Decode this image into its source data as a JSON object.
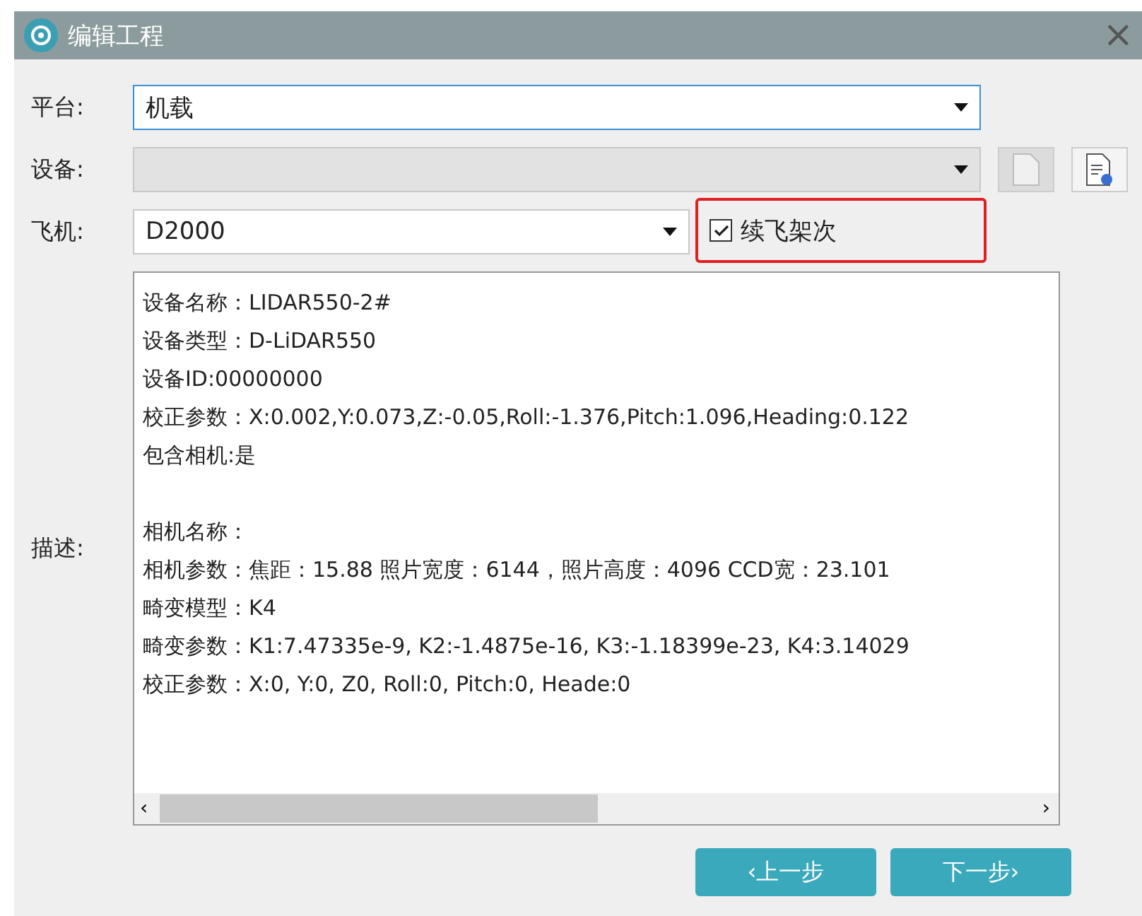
{
  "window": {
    "title": "编辑工程",
    "close": "×"
  },
  "fields": [
    {
      "label": "平台:",
      "value": "机载",
      "focused": true,
      "disabled": false
    },
    {
      "label": "设备:",
      "focused": false,
      "disabled": true
    },
    {
      "label": "飞机:",
      "value": "D2000",
      "focused": false,
      "disabled": false
    }
  ],
  "resume_checkbox": {
    "label": "续飞架次",
    "checked": true
  },
  "description": {
    "label": "描述:",
    "scroll_left": "‹",
    "scroll_right": "›",
    "device_lines": [
      "设备名称：LIDAR550-2#",
      "设备类型：D-LiDAR550",
      "设备ID:00000000",
      "校正参数：X:0.002,Y:0.073,Z:-0.05,Roll:-1.376,Pitch:1.096,Heading:0.122",
      "包含相机:是"
    ],
    "camera_lines": [
      "相机名称：",
      "相机参数：焦距：15.88 照片宽度：6144，照片高度：4096 CCD宽：23.101",
      "畸变模型：K4",
      "畸变参数：K1:7.47335e-9, K2:-1.4875e-16, K3:-1.18399e-23, K4:3.14029",
      "校正参数：X:0, Y:0, Z0, Roll:0, Pitch:0, Heade:0"
    ]
  },
  "buttons": [
    {
      "label": "‹上一步"
    },
    {
      "label": "下一步›"
    }
  ]
}
